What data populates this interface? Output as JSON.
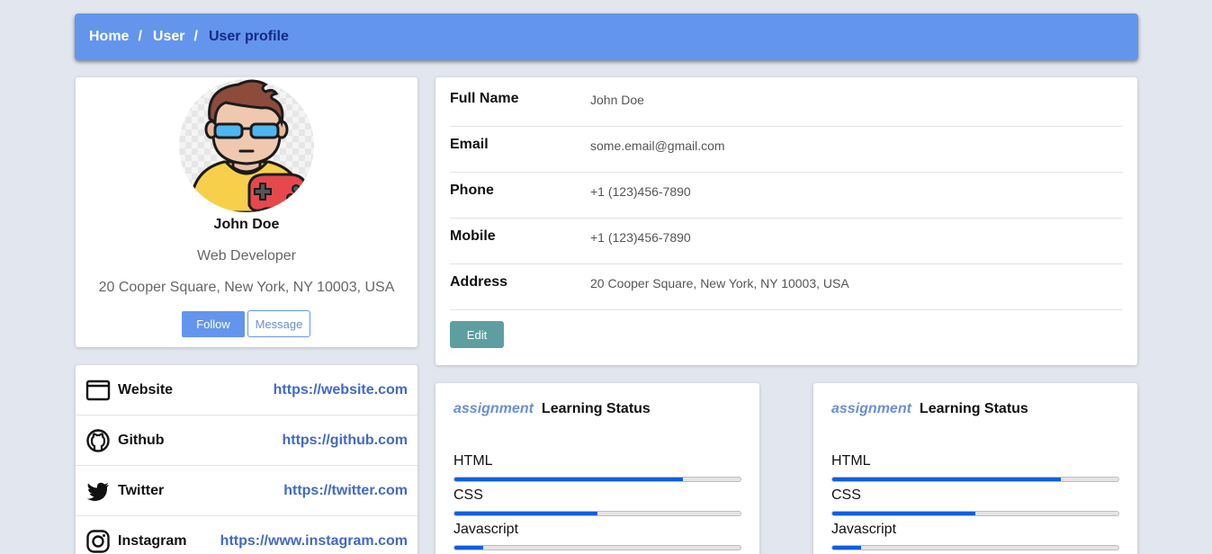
{
  "breadcrumb": {
    "items": [
      "Home",
      "User"
    ],
    "current": "User profile",
    "separator": "/"
  },
  "profile": {
    "name": "John Doe",
    "role": "Web Developer",
    "address": "20 Cooper Square, New York, NY 10003, USA",
    "follow_label": "Follow",
    "message_label": "Message"
  },
  "social": [
    {
      "label": "Website",
      "url": "https://website.com",
      "icon": "browser-icon"
    },
    {
      "label": "Github",
      "url": "https://github.com",
      "icon": "github-icon"
    },
    {
      "label": "Twitter",
      "url": "https://twitter.com",
      "icon": "twitter-icon"
    },
    {
      "label": "Instagram",
      "url": "https://www.instagram.com",
      "icon": "instagram-icon"
    }
  ],
  "details": {
    "rows": [
      {
        "label": "Full Name",
        "value": "John Doe"
      },
      {
        "label": "Email",
        "value": "some.email@gmail.com"
      },
      {
        "label": "Phone",
        "value": "+1 (123)456-7890"
      },
      {
        "label": "Mobile",
        "value": "+1 (123)456-7890"
      },
      {
        "label": "Address",
        "value": "20 Cooper Square, New York, NY 10003, USA"
      }
    ],
    "edit_label": "Edit"
  },
  "learning": [
    {
      "tag": "assignment",
      "title": "Learning Status",
      "skills": [
        {
          "name": "HTML",
          "progress": 0.8
        },
        {
          "name": "CSS",
          "progress": 0.5
        },
        {
          "name": "Javascript",
          "progress": 0.1
        }
      ]
    },
    {
      "tag": "assignment",
      "title": "Learning Status",
      "skills": [
        {
          "name": "HTML",
          "progress": 0.8
        },
        {
          "name": "CSS",
          "progress": 0.5
        },
        {
          "name": "Javascript",
          "progress": 0.1
        }
      ]
    }
  ],
  "colors": {
    "accent": "#6495ed",
    "edit_button": "#5f9ea0",
    "progress_fill": "#0b5fe0",
    "link": "#4169c6"
  }
}
